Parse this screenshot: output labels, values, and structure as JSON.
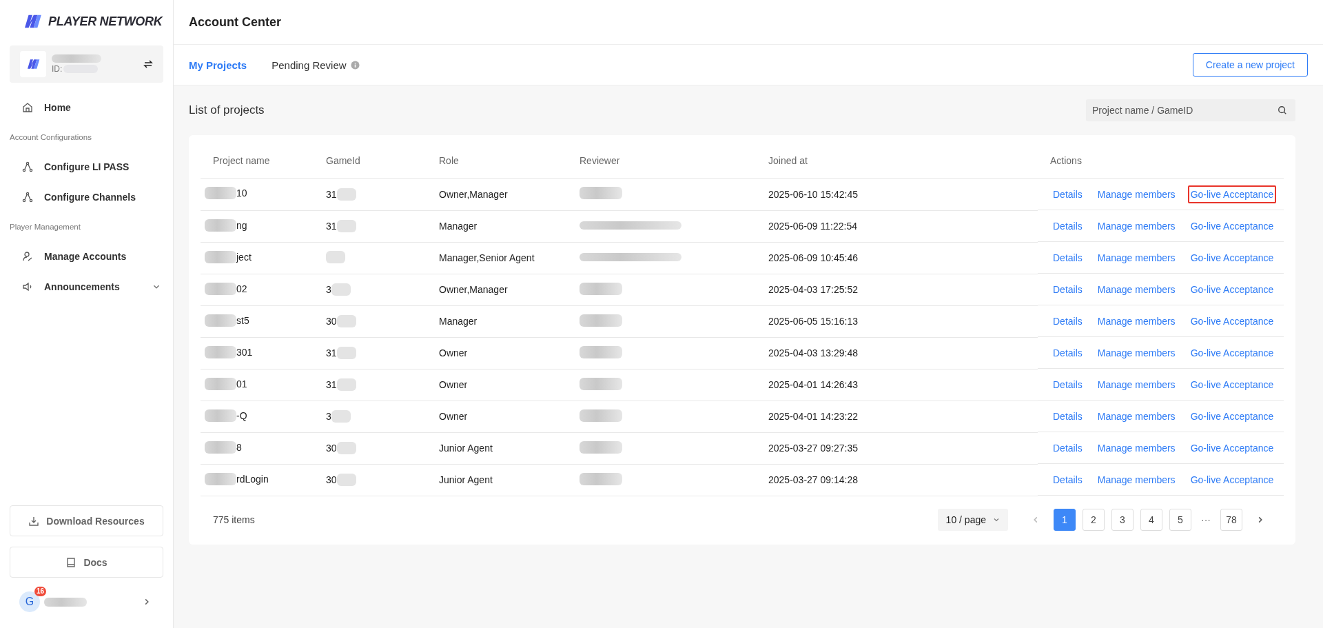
{
  "brand": {
    "name": "PLAYER NETWORK"
  },
  "account": {
    "id_label": "ID:"
  },
  "sidebar": {
    "items": [
      {
        "kind": "item",
        "label": "Home"
      },
      {
        "kind": "section",
        "label": "Account Configurations"
      },
      {
        "kind": "item",
        "label": "Configure LI PASS"
      },
      {
        "kind": "item",
        "label": "Configure Channels"
      },
      {
        "kind": "section",
        "label": "Player Management"
      },
      {
        "kind": "item",
        "label": "Manage Accounts"
      },
      {
        "kind": "item",
        "label": "Announcements",
        "expanded": false
      }
    ],
    "buttons": [
      {
        "label": "Download Resources"
      },
      {
        "label": "Docs"
      }
    ],
    "user": {
      "initial": "G",
      "badge": "16"
    }
  },
  "header": {
    "title": "Account Center"
  },
  "tabs": [
    {
      "label": "My Projects",
      "selected": true
    },
    {
      "label": "Pending Review",
      "selected": false,
      "info": true
    }
  ],
  "create_button": "Create a new project",
  "list_title": "List of projects",
  "search": {
    "placeholder": "Project name / GameID"
  },
  "table": {
    "columns": [
      "Project name",
      "GameId",
      "Role",
      "Reviewer",
      "Joined at",
      "Actions"
    ],
    "rows": [
      {
        "name": "10",
        "game_id": "31",
        "role": "Owner,Manager",
        "joined": "2025-06-10 15:42:45",
        "actions": [
          "Details",
          "Manage members",
          "Go-live Acceptance"
        ],
        "outlined": true
      },
      {
        "name": "ng",
        "game_id": "31",
        "role": "Manager",
        "joined": "2025-06-09 11:22:54",
        "actions": [
          "Details",
          "Manage members",
          "Go-live Acceptance"
        ],
        "outlined": false
      },
      {
        "name": "ject",
        "role": "Manager,Senior Agent",
        "joined": "2025-06-09 10:45:46",
        "actions": [
          "Details",
          "Manage members",
          "Go-live Acceptance"
        ],
        "outlined": false
      },
      {
        "name": "02",
        "game_id": "3",
        "role": "Owner,Manager",
        "joined": "2025-04-03 17:25:52",
        "actions": [
          "Details",
          "Manage members",
          "Go-live Acceptance"
        ],
        "outlined": false
      },
      {
        "name": "st5",
        "game_id": "30",
        "role": "Manager",
        "joined": "2025-06-05 15:16:13",
        "actions": [
          "Details",
          "Manage members",
          "Go-live Acceptance"
        ],
        "outlined": false
      },
      {
        "name": "301",
        "game_id": "31",
        "role": "Owner",
        "joined": "2025-04-03 13:29:48",
        "actions": [
          "Details",
          "Manage members",
          "Go-live Acceptance"
        ],
        "outlined": false
      },
      {
        "name": "01",
        "game_id": "31",
        "role": "Owner",
        "joined": "2025-04-01 14:26:43",
        "actions": [
          "Details",
          "Manage members",
          "Go-live Acceptance"
        ],
        "outlined": false
      },
      {
        "name": "-Q",
        "game_id": "3",
        "role": "Owner",
        "joined": "2025-04-01 14:23:22",
        "actions": [
          "Details",
          "Manage members",
          "Go-live Acceptance"
        ],
        "outlined": false
      },
      {
        "name": "8",
        "game_id": "30",
        "role": "Junior Agent",
        "joined": "2025-03-27 09:27:35",
        "actions": [
          "Details",
          "Manage members",
          "Go-live Acceptance"
        ],
        "outlined": false
      },
      {
        "name": "rdLogin",
        "game_id": "30",
        "role": "Junior Agent",
        "joined": "2025-03-27 09:14:28",
        "actions": [
          "Details",
          "Manage members",
          "Go-live Acceptance"
        ],
        "outlined": false
      }
    ]
  },
  "pagination": {
    "total": "775 items",
    "page_size": "10 / page",
    "pages": [
      {
        "kind": "page",
        "label": "1",
        "selected": true
      },
      {
        "kind": "page",
        "label": "2",
        "selected": false
      },
      {
        "kind": "page",
        "label": "3",
        "selected": false
      },
      {
        "kind": "page",
        "label": "4",
        "selected": false
      },
      {
        "kind": "page",
        "label": "5",
        "selected": false
      },
      {
        "kind": "ellipsis",
        "label": "···"
      },
      {
        "kind": "page",
        "label": "78",
        "selected": false
      }
    ]
  }
}
